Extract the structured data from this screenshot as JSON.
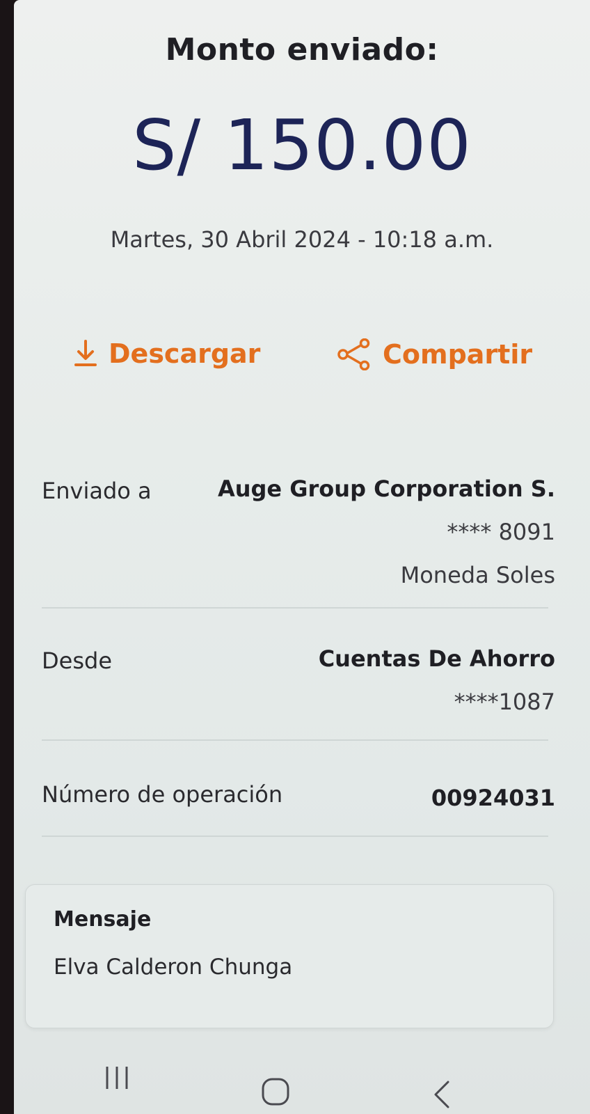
{
  "header": {
    "title": "Monto enviado:",
    "amount": "S/ 150.00",
    "datetime": "Martes, 30 Abril 2024 - 10:18 a.m."
  },
  "actions": {
    "download_label": "Descargar",
    "download_icon": "download-icon",
    "share_label": "Compartir",
    "share_icon": "share-icon",
    "accent_color": "#e36f1e"
  },
  "details": {
    "recipient": {
      "label": "Enviado a",
      "name": "Auge Group Corporation S.",
      "account": "**** 8091",
      "currency": "Moneda Soles"
    },
    "source": {
      "label": "Desde",
      "account_type": "Cuentas De Ahorro",
      "account": "****1087"
    },
    "operation": {
      "label": "Número de operación",
      "number": "00924031"
    }
  },
  "message": {
    "label": "Mensaje",
    "text": "Elva Calderon Chunga"
  },
  "navbar": {
    "recent_icon": "recent-apps-icon",
    "home_icon": "home-icon",
    "back_icon": "back-icon"
  },
  "colors": {
    "amount": "#1d2457",
    "accent": "#e36f1e"
  }
}
